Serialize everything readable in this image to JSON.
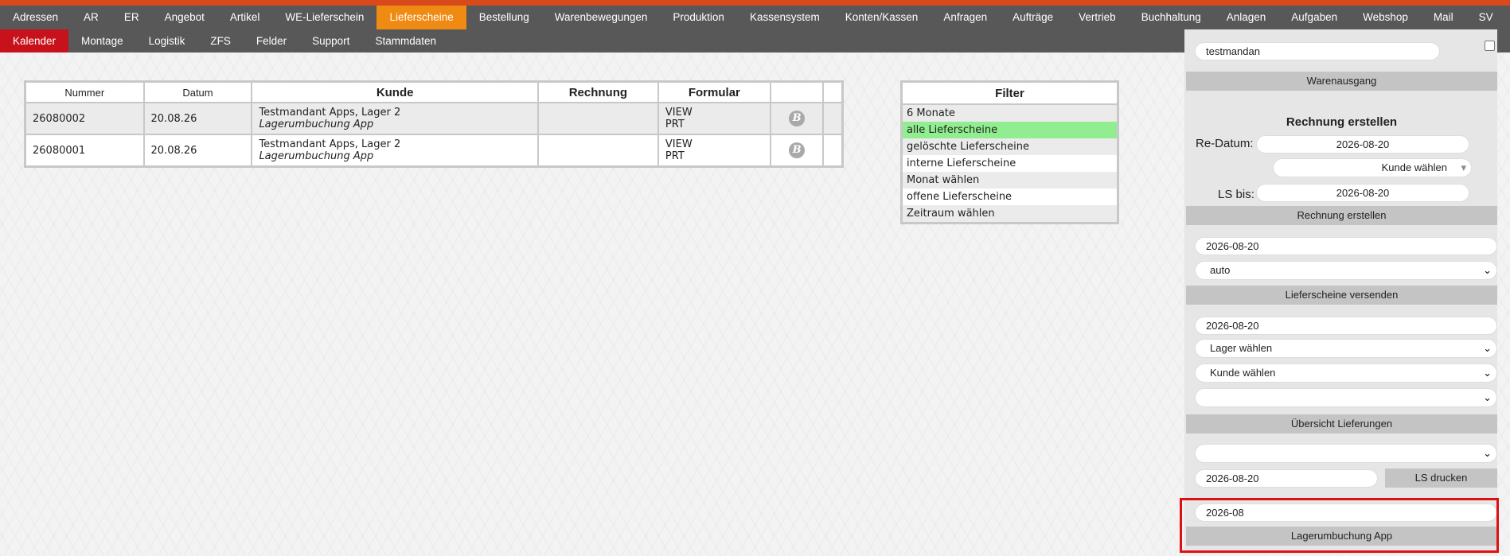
{
  "nav_main": [
    "Adressen",
    "AR",
    "ER",
    "Angebot",
    "Artikel",
    "WE-Lieferschein",
    "Lieferscheine",
    "Bestellung",
    "Warenbewegungen",
    "Produktion",
    "Kassensystem",
    "Konten/Kassen",
    "Anfragen",
    "Aufträge",
    "Vertrieb",
    "Buchhaltung",
    "Anlagen",
    "Aufgaben",
    "Webshop",
    "Mail",
    "SV"
  ],
  "nav_main_active": "Lieferscheine",
  "nav_sub": [
    "Kalender",
    "Montage",
    "Logistik",
    "ZFS",
    "Felder",
    "Support",
    "Stammdaten"
  ],
  "nav_sub_active": "Kalender",
  "table": {
    "headers": [
      "Nummer",
      "Datum",
      "Kunde",
      "Rechnung",
      "Formular",
      ""
    ],
    "rows": [
      {
        "nummer": "26080002",
        "datum": "20.08.26",
        "kunde": "Testmandant Apps, Lager 2",
        "kunde2": "Lagerumbuchung App",
        "rechnung": "",
        "formular1": "VIEW",
        "formular2": "PRT"
      },
      {
        "nummer": "26080001",
        "datum": "20.08.26",
        "kunde": "Testmandant Apps, Lager 2",
        "kunde2": "Lagerumbuchung App",
        "rechnung": "",
        "formular1": "VIEW",
        "formular2": "PRT"
      }
    ],
    "icon_glyph": "B"
  },
  "filter": {
    "title": "Filter",
    "items": [
      "6 Monate",
      "alle Lieferscheine",
      "gelöschte Lieferscheine",
      "interne Lieferscheine",
      "Monat wählen",
      "offene Lieferscheine",
      "Zeitraum wählen"
    ],
    "selected": "alle Lieferscheine"
  },
  "sidebar": {
    "mandant": "testmandan",
    "warenausgang": "Warenausgang",
    "rechnung_title": "Rechnung erstellen",
    "re_datum_label": "Re-Datum:",
    "re_datum": "2026-08-20",
    "kunde_select": "Kunde wählen",
    "ls_bis_label": "LS bis:",
    "ls_bis": "2026-08-20",
    "rechnung_bar": "Rechnung erstellen",
    "versand_date": "2026-08-20",
    "versand_select": "auto",
    "versand_bar": "Lieferscheine versenden",
    "uebersicht_date": "2026-08-20",
    "lager_select": "Lager wählen",
    "kunde_select2": "Kunde wählen",
    "empty_select": "",
    "uebersicht_bar": "Übersicht Lieferungen",
    "druck_select": "",
    "druck_date": "2026-08-20",
    "druck_button": "LS drucken",
    "month": "2026-08",
    "lagerumbuchung_button": "Lagerumbuchung App"
  }
}
